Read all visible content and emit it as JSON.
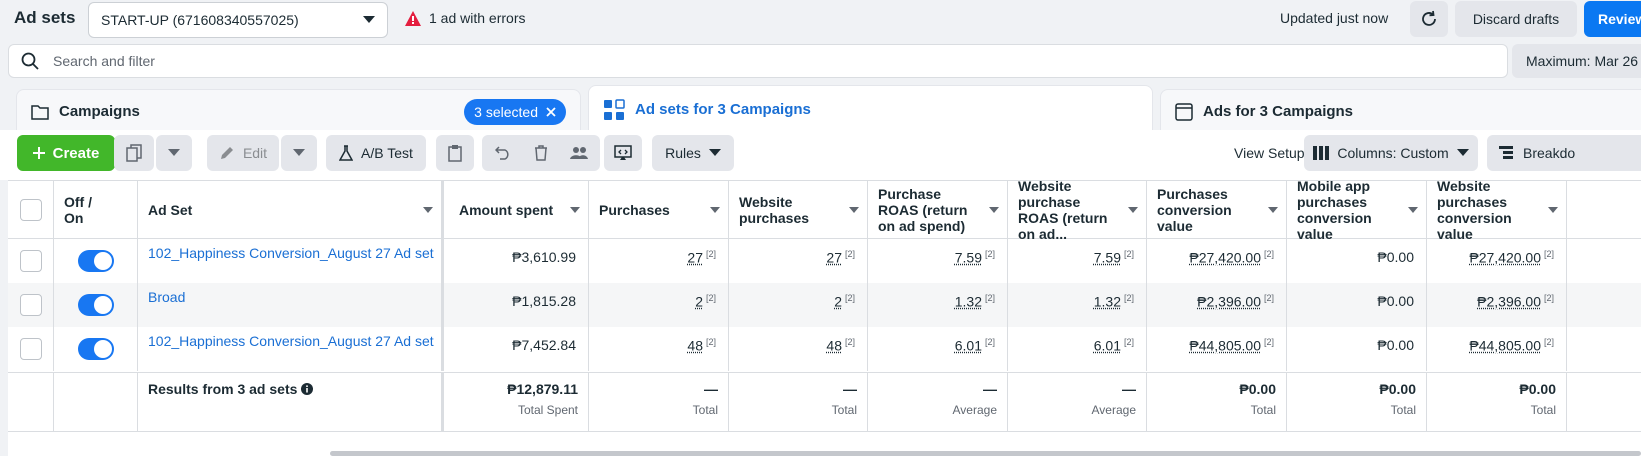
{
  "header": {
    "title": "Ad sets",
    "account": "START-UP (671608340557025)",
    "error_text": "1 ad with errors",
    "updated": "Updated just now",
    "discard": "Discard drafts",
    "review": "Review"
  },
  "search": {
    "placeholder": "Search and filter",
    "date": "Maximum: Mar 26"
  },
  "tabs": {
    "campaigns": "Campaigns",
    "selected": "3 selected",
    "adsets": "Ad sets for 3 Campaigns",
    "ads": "Ads for 3 Campaigns"
  },
  "toolbar": {
    "create": "Create",
    "edit": "Edit",
    "abtest": "A/B Test",
    "rules": "Rules",
    "view_setup": "View Setup",
    "columns": "Columns: Custom",
    "breakdown": "Breakdo"
  },
  "table": {
    "headers": {
      "offon": "Off / On",
      "adset": "Ad Set",
      "amount": "Amount spent",
      "purchases": "Purchases",
      "web_purchases": "Website purchases",
      "roas": "Purchase ROAS (return on ad spend)",
      "web_roas": "Website purchase ROAS (return on ad...",
      "conv_value": "Purchases conversion value",
      "mobile_conv": "Mobile app purchases conversion value",
      "web_conv": "Website purchases conversion value"
    },
    "rows": [
      {
        "name": "102_Happiness Conversion_August 27 Ad set",
        "amount": "₱3,610.99",
        "purchases": "27",
        "web_purchases": "27",
        "roas": "7.59",
        "web_roas": "7.59",
        "conv_value": "₱27,420.00",
        "mobile_conv": "₱0.00",
        "web_conv": "₱27,420.00",
        "note": "[2]"
      },
      {
        "name": "Broad",
        "amount": "₱1,815.28",
        "purchases": "2",
        "web_purchases": "2",
        "roas": "1.32",
        "web_roas": "1.32",
        "conv_value": "₱2,396.00",
        "mobile_conv": "₱0.00",
        "web_conv": "₱2,396.00",
        "note": "[2]"
      },
      {
        "name": "102_Happiness Conversion_August 27 Ad set",
        "amount": "₱7,452.84",
        "purchases": "48",
        "web_purchases": "48",
        "roas": "6.01",
        "web_roas": "6.01",
        "conv_value": "₱44,805.00",
        "mobile_conv": "₱0.00",
        "web_conv": "₱44,805.00",
        "note": "[2]"
      }
    ],
    "totals": {
      "label": "Results from 3 ad sets",
      "amount": "₱12,879.11",
      "amount_sub": "Total Spent",
      "purchases": "—",
      "purchases_sub": "Total",
      "web_purchases": "—",
      "web_purchases_sub": "Total",
      "roas": "—",
      "roas_sub": "Average",
      "web_roas": "—",
      "web_roas_sub": "Average",
      "conv_value": "₱0.00",
      "conv_value_sub": "Total",
      "mobile_conv": "₱0.00",
      "mobile_conv_sub": "Total",
      "web_conv": "₱0.00",
      "web_conv_sub": "Total"
    }
  }
}
